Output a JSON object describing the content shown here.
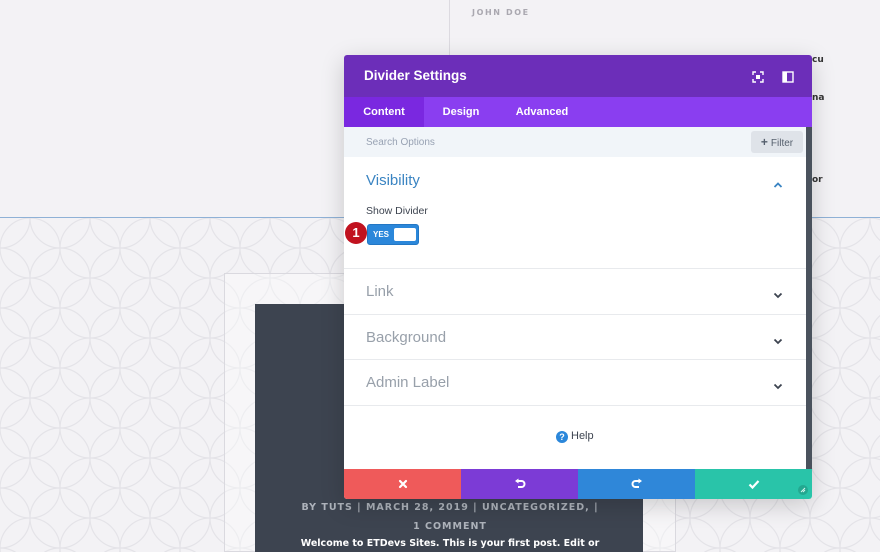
{
  "background": {
    "author": "JOHN DOE",
    "fragments": [
      "cu",
      "na",
      "or"
    ],
    "post_meta": "BY TUTS | MARCH 28, 2019 | UNCATEGORIZED, | 1 COMMENT",
    "excerpt": "Welcome to ETDevs Sites. This is your first post. Edit or"
  },
  "modal": {
    "title": "Divider Settings",
    "header_icons": [
      "fullscreen-icon",
      "sidebar-split-icon"
    ],
    "tabs": [
      {
        "label": "Content",
        "active": true
      },
      {
        "label": "Design",
        "active": false
      },
      {
        "label": "Advanced",
        "active": false
      }
    ],
    "search": {
      "placeholder": "Search Options"
    },
    "filter": {
      "label": "Filter"
    },
    "sections": [
      {
        "title": "Visibility",
        "open": true
      },
      {
        "title": "Link",
        "open": false
      },
      {
        "title": "Background",
        "open": false
      },
      {
        "title": "Admin Label",
        "open": false
      }
    ],
    "visibility": {
      "field_label": "Show Divider",
      "toggle_value": "YES",
      "toggle_on": true
    },
    "help": {
      "label": "Help"
    },
    "footer": {
      "buttons": [
        "discard",
        "undo",
        "redo",
        "save"
      ],
      "colors": {
        "discard": "#ef5a5a",
        "undo": "#7c3bd6",
        "redo": "#2f87d9",
        "save": "#29c4a9"
      }
    }
  },
  "annotation": {
    "badge": "1"
  },
  "colors": {
    "header": "#6c2eb9",
    "tabs": "#8a3ef0",
    "accent": "#2b87da",
    "badge": "#c1121f"
  }
}
